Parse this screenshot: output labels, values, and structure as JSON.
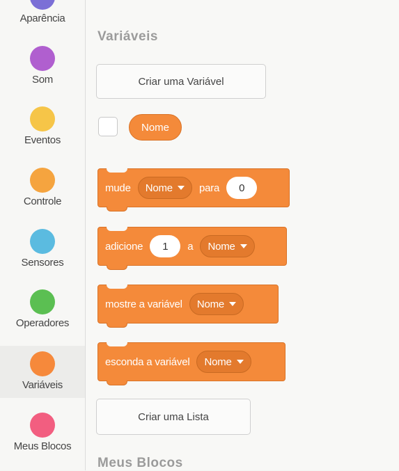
{
  "categories": [
    {
      "label": "Aparência",
      "color": "#7b6fd6",
      "icon": "looks-category-icon"
    },
    {
      "label": "Som",
      "color": "#b05fcf",
      "icon": "sound-category-icon"
    },
    {
      "label": "Eventos",
      "color": "#f6c548",
      "icon": "events-category-icon"
    },
    {
      "label": "Controle",
      "color": "#f5a43f",
      "icon": "control-category-icon"
    },
    {
      "label": "Sensores",
      "color": "#5bbbe0",
      "icon": "sensing-category-icon"
    },
    {
      "label": "Operadores",
      "color": "#5bbf52",
      "icon": "operators-category-icon"
    },
    {
      "label": "Variáveis",
      "color": "#f6893b",
      "icon": "variables-category-icon"
    },
    {
      "label": "Meus Blocos",
      "color": "#f25e80",
      "icon": "my-blocks-category-icon"
    }
  ],
  "palette": {
    "heading": "Variáveis",
    "create_variable_label": "Criar uma Variável",
    "variable_reporter": "Nome",
    "blocks": {
      "set": {
        "word1": "mude",
        "var": "Nome",
        "word2": "para",
        "value": "0"
      },
      "change": {
        "word1": "adicione",
        "value": "1",
        "word2": "a",
        "var": "Nome"
      },
      "show": {
        "word1": "mostre a variável",
        "var": "Nome"
      },
      "hide": {
        "word1": "esconda a variável",
        "var": "Nome"
      }
    },
    "create_list_label": "Criar uma Lista",
    "next_heading": "Meus Blocos"
  },
  "colors": {
    "variables_block": "#f48a3a"
  }
}
